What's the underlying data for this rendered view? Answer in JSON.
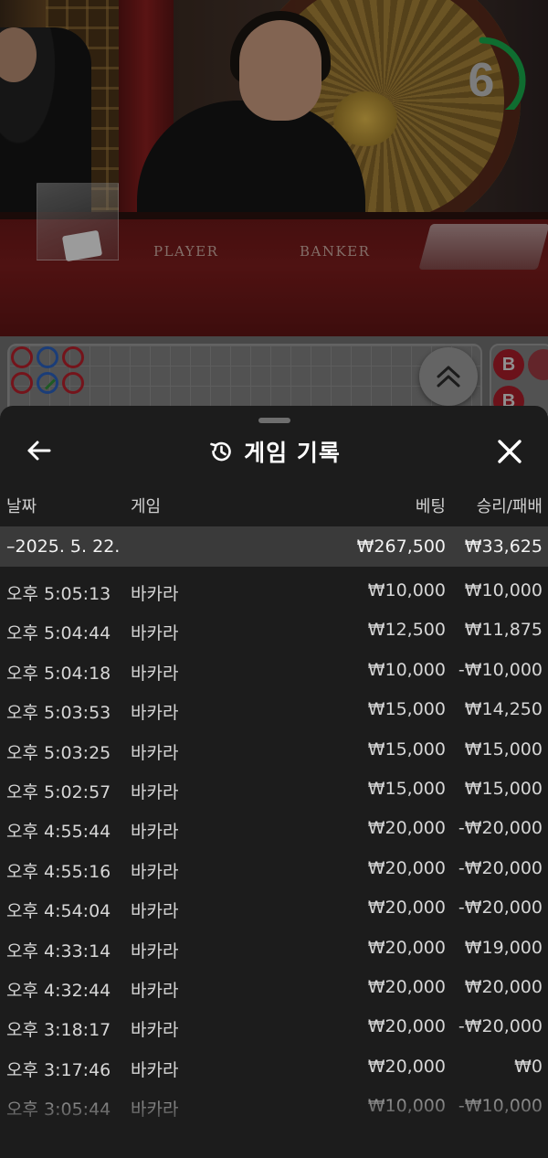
{
  "video": {
    "table_labels": {
      "player": "PLAYER",
      "banker": "BANKER"
    },
    "timer": {
      "seconds": "6",
      "progress": 0.55,
      "color": "#18a84a"
    }
  },
  "roads": {
    "big_road_letter": "B",
    "colors": {
      "banker": "#b3202a",
      "player": "#2a5fb8",
      "tie": "#2f8a3a"
    }
  },
  "sheet": {
    "title": "게임 기록",
    "icons": {
      "back": "arrow-left-icon",
      "history": "history-icon",
      "close": "close-icon",
      "expand": "chevron-double-up-icon"
    },
    "columns": {
      "date": "날짜",
      "game": "게임",
      "bet": "베팅",
      "win_loss": "승리/패배"
    },
    "summary": {
      "date": "–2025. 5. 22.",
      "bet": "₩267,500",
      "win_loss": "₩33,625"
    },
    "rows": [
      {
        "time": "오후 5:05:13",
        "game": "바카라",
        "bet": "₩10,000",
        "win_loss": "₩10,000"
      },
      {
        "time": "오후 5:04:44",
        "game": "바카라",
        "bet": "₩12,500",
        "win_loss": "₩11,875"
      },
      {
        "time": "오후 5:04:18",
        "game": "바카라",
        "bet": "₩10,000",
        "win_loss": "-₩10,000"
      },
      {
        "time": "오후 5:03:53",
        "game": "바카라",
        "bet": "₩15,000",
        "win_loss": "₩14,250"
      },
      {
        "time": "오후 5:03:25",
        "game": "바카라",
        "bet": "₩15,000",
        "win_loss": "₩15,000"
      },
      {
        "time": "오후 5:02:57",
        "game": "바카라",
        "bet": "₩15,000",
        "win_loss": "₩15,000"
      },
      {
        "time": "오후 4:55:44",
        "game": "바카라",
        "bet": "₩20,000",
        "win_loss": "-₩20,000"
      },
      {
        "time": "오후 4:55:16",
        "game": "바카라",
        "bet": "₩20,000",
        "win_loss": "-₩20,000"
      },
      {
        "time": "오후 4:54:04",
        "game": "바카라",
        "bet": "₩20,000",
        "win_loss": "-₩20,000"
      },
      {
        "time": "오후 4:33:14",
        "game": "바카라",
        "bet": "₩20,000",
        "win_loss": "₩19,000"
      },
      {
        "time": "오후 4:32:44",
        "game": "바카라",
        "bet": "₩20,000",
        "win_loss": "₩20,000"
      },
      {
        "time": "오후 3:18:17",
        "game": "바카라",
        "bet": "₩20,000",
        "win_loss": "-₩20,000"
      },
      {
        "time": "오후 3:17:46",
        "game": "바카라",
        "bet": "₩20,000",
        "win_loss": "₩0"
      },
      {
        "time": "오후 3:05:44",
        "game": "바카라",
        "bet": "₩10,000",
        "win_loss": "-₩10,000"
      }
    ]
  }
}
